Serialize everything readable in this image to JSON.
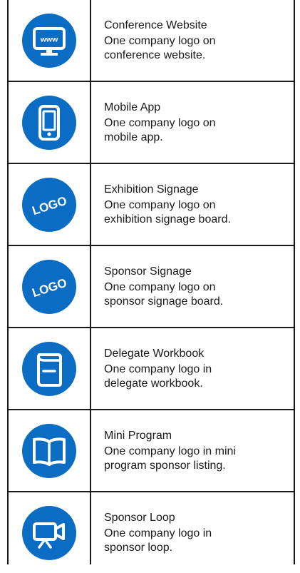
{
  "items": [
    {
      "title": "Conference Website",
      "description": "One company logo on\nconference website.",
      "icon": "website-icon",
      "icon_text": "www"
    },
    {
      "title": "Mobile App",
      "description": "One company logo on\nmobile app.",
      "icon": "mobile-phone-icon"
    },
    {
      "title": "Exhibition Signage",
      "description": "One company logo on\nexhibition signage board.",
      "icon": "logo-icon",
      "icon_text": "LOGO"
    },
    {
      "title": "Sponsor Signage",
      "description": "One company logo on\nsponsor signage board.",
      "icon": "logo-icon",
      "icon_text": "LOGO"
    },
    {
      "title": "Delegate Workbook",
      "description": "One company logo in\ndelegate workbook.",
      "icon": "workbook-icon"
    },
    {
      "title": "Mini Program",
      "description": "One company logo in mini\nprogram sponsor listing.",
      "icon": "open-book-icon"
    },
    {
      "title": "Sponsor Loop",
      "description": "One company logo in\nsponsor loop.",
      "icon": "video-camera-icon"
    }
  ],
  "colors": {
    "icon_background": "#0a6cc2",
    "icon_foreground": "#ffffff",
    "border": "#1a1a1a",
    "text": "#1a1a1a"
  }
}
